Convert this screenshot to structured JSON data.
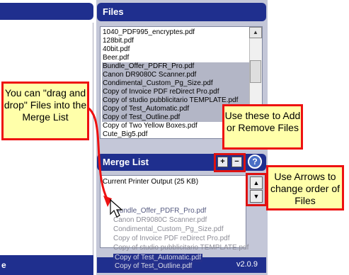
{
  "left_panel": {
    "footer_fragment": "e"
  },
  "files_panel": {
    "title": "Files",
    "items": [
      {
        "name": "1040_PDF995_encryptes.pdf",
        "selected": false
      },
      {
        "name": "128bit.pdf",
        "selected": false
      },
      {
        "name": "40bit.pdf",
        "selected": false
      },
      {
        "name": "Beer.pdf",
        "selected": false
      },
      {
        "name": "Bundle_Offer_PDFR_Pro.pdf",
        "selected": true
      },
      {
        "name": "Canon DR9080C Scanner.pdf",
        "selected": true
      },
      {
        "name": "Condimental_Custom_Pg_Size.pdf",
        "selected": true
      },
      {
        "name": "Copy of Invoice PDF reDirect Pro.pdf",
        "selected": true
      },
      {
        "name": "Copy of studio pubblicitario TEMPLATE.pdf",
        "selected": true
      },
      {
        "name": "Copy of Test_Automatic.pdf",
        "selected": true
      },
      {
        "name": "Copy of Test_Outline.pdf",
        "selected": true
      },
      {
        "name": "Copy of Two Yellow Boxes.pdf",
        "selected": false
      },
      {
        "name": "Cute_Big5.pdf",
        "selected": false
      }
    ]
  },
  "merge_panel": {
    "title": "Merge List",
    "add_label": "+",
    "remove_label": "−",
    "help_label": "?",
    "items": [
      "Current Printer Output (25 KB)"
    ],
    "up_arrow": "▲",
    "down_arrow": "▼"
  },
  "drag_ghost": [
    "Bundle_Offer_PDFR_Pro.pdf",
    "Canon DR9080C Scanner.pdf",
    "Condimental_Custom_Pg_Size.pdf",
    "Copy of Invoice PDF reDirect Pro.pdf",
    "Copy of studio pubblicitario TEMPLATE.pdf",
    "Copy of Test_Automatic.pdf",
    "Copy of Test_Outline.pdf"
  ],
  "version": "v2.0.9",
  "callouts": {
    "drag": "You can \"drag and drop\" Files into the Merge List",
    "add_remove": "Use these to Add or Remove Files",
    "arrows": "Use Arrows to change order of Files"
  },
  "colors": {
    "panel_header": "#1f2f8e",
    "callout_fill": "#ffffaa",
    "callout_border": "#e11"
  }
}
